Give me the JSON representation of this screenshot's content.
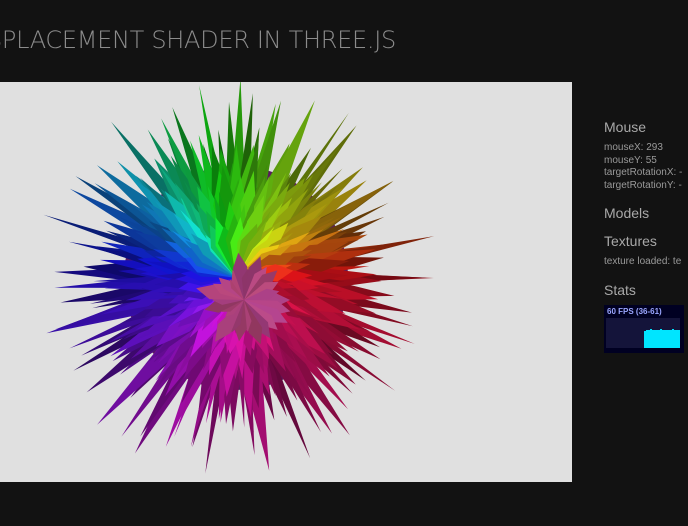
{
  "header": {
    "title": "SPLACEMENT SHADER IN THREE.JS"
  },
  "viewport": {
    "background": "#e0e0e0",
    "object": "displaced-spiky-sphere"
  },
  "sidebar": {
    "mouse": {
      "title": "Mouse",
      "lines": [
        "mouseX: 293",
        "mouseY: 55",
        "targetRotationX: -",
        "targetRotationY: -"
      ]
    },
    "models": {
      "title": "Models"
    },
    "textures": {
      "title": "Textures",
      "lines": [
        "texture loaded: te"
      ]
    },
    "stats": {
      "title": "Stats",
      "fps_label": "60 FPS (36-61)",
      "history": [
        0.58,
        0.6,
        0.6,
        0.62,
        0.6,
        0.6,
        0.61,
        0.6,
        0.62,
        0.6,
        0.6,
        0.6,
        0.61,
        0.6,
        0.62,
        0.6,
        0.6,
        0.6
      ]
    }
  },
  "colors": {
    "page_bg": "#121212",
    "stats_bar": "#00e5ff",
    "stats_bg": "#000022"
  }
}
